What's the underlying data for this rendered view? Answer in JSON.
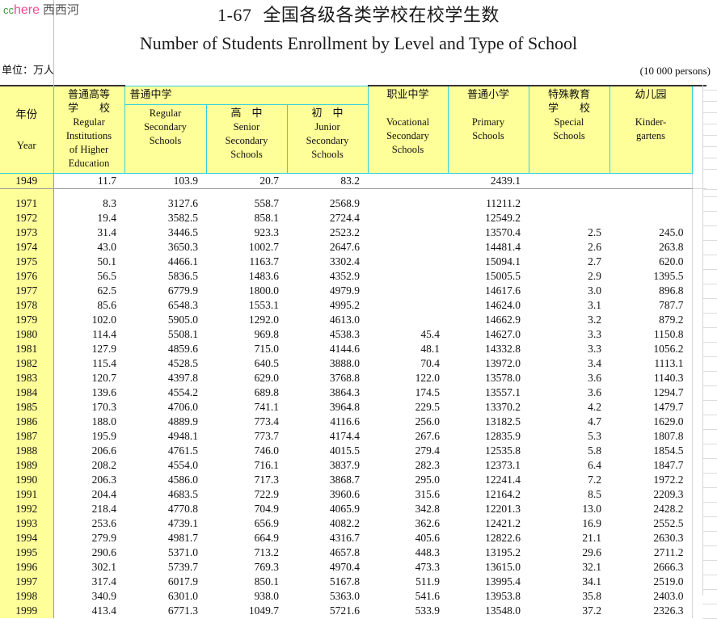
{
  "watermark": {
    "cc": "cc",
    "here": "here",
    "site_cn": "西西河"
  },
  "title": {
    "number": "1-67",
    "cn": "全国各级各类学校在校学生数",
    "en": "Number of Students Enrollment by Level and Type of School"
  },
  "unit": {
    "cn": "单位：万人",
    "en": "(10 000 persons)"
  },
  "header": {
    "year": {
      "cn": "年份",
      "en": "Year"
    },
    "higher": {
      "cn1": "普通高等",
      "cn2": "学　　校",
      "en": [
        "Regular",
        "Institutions",
        "of Higher",
        "Education"
      ]
    },
    "secondary_group": {
      "cn": "普通中学"
    },
    "regular_secondary": {
      "en": [
        "Regular",
        "Secondary",
        "Schools"
      ]
    },
    "senior": {
      "cn": "高　中",
      "en": [
        "Senior",
        "Secondary",
        "Schools"
      ]
    },
    "junior": {
      "cn": "初　中",
      "en": [
        "Junior",
        "Secondary",
        "Schools"
      ]
    },
    "vocational": {
      "cn": "职业中学",
      "en": [
        "Vocational",
        "Secondary",
        "Schools"
      ]
    },
    "primary": {
      "cn": "普通小学",
      "en": [
        "Primary",
        "Schools"
      ]
    },
    "special": {
      "cn1": "特殊教育",
      "cn2": "学　　校",
      "en": [
        "Special",
        "Schools"
      ]
    },
    "kindergarten": {
      "cn": "幼儿园",
      "en": [
        "Kinder-",
        "gartens"
      ]
    }
  },
  "chart_data": {
    "type": "table",
    "title": "1-67  全国各级各类学校在校学生数 / Number of Students Enrollment by Level and Type of School",
    "unit": "10 000 persons",
    "columns": [
      "Year",
      "Regular Institutions of Higher Education",
      "Regular Secondary Schools",
      "Senior Secondary Schools",
      "Junior Secondary Schools",
      "Vocational Secondary Schools",
      "Primary Schools",
      "Special Schools",
      "Kindergartens"
    ],
    "rows": [
      [
        "1949",
        "11.7",
        "103.9",
        "20.7",
        "83.2",
        "",
        "2439.1",
        "",
        ""
      ],
      [
        "1971",
        "8.3",
        "3127.6",
        "558.7",
        "2568.9",
        "",
        "11211.2",
        "",
        ""
      ],
      [
        "1972",
        "19.4",
        "3582.5",
        "858.1",
        "2724.4",
        "",
        "12549.2",
        "",
        ""
      ],
      [
        "1973",
        "31.4",
        "3446.5",
        "923.3",
        "2523.2",
        "",
        "13570.4",
        "2.5",
        "245.0"
      ],
      [
        "1974",
        "43.0",
        "3650.3",
        "1002.7",
        "2647.6",
        "",
        "14481.4",
        "2.6",
        "263.8"
      ],
      [
        "1975",
        "50.1",
        "4466.1",
        "1163.7",
        "3302.4",
        "",
        "15094.1",
        "2.7",
        "620.0"
      ],
      [
        "1976",
        "56.5",
        "5836.5",
        "1483.6",
        "4352.9",
        "",
        "15005.5",
        "2.9",
        "1395.5"
      ],
      [
        "1977",
        "62.5",
        "6779.9",
        "1800.0",
        "4979.9",
        "",
        "14617.6",
        "3.0",
        "896.8"
      ],
      [
        "1978",
        "85.6",
        "6548.3",
        "1553.1",
        "4995.2",
        "",
        "14624.0",
        "3.1",
        "787.7"
      ],
      [
        "1979",
        "102.0",
        "5905.0",
        "1292.0",
        "4613.0",
        "",
        "14662.9",
        "3.2",
        "879.2"
      ],
      [
        "1980",
        "114.4",
        "5508.1",
        "969.8",
        "4538.3",
        "45.4",
        "14627.0",
        "3.3",
        "1150.8"
      ],
      [
        "1981",
        "127.9",
        "4859.6",
        "715.0",
        "4144.6",
        "48.1",
        "14332.8",
        "3.3",
        "1056.2"
      ],
      [
        "1982",
        "115.4",
        "4528.5",
        "640.5",
        "3888.0",
        "70.4",
        "13972.0",
        "3.4",
        "1113.1"
      ],
      [
        "1983",
        "120.7",
        "4397.8",
        "629.0",
        "3768.8",
        "122.0",
        "13578.0",
        "3.6",
        "1140.3"
      ],
      [
        "1984",
        "139.6",
        "4554.2",
        "689.8",
        "3864.3",
        "174.5",
        "13557.1",
        "3.6",
        "1294.7"
      ],
      [
        "1985",
        "170.3",
        "4706.0",
        "741.1",
        "3964.8",
        "229.5",
        "13370.2",
        "4.2",
        "1479.7"
      ],
      [
        "1986",
        "188.0",
        "4889.9",
        "773.4",
        "4116.6",
        "256.0",
        "13182.5",
        "4.7",
        "1629.0"
      ],
      [
        "1987",
        "195.9",
        "4948.1",
        "773.7",
        "4174.4",
        "267.6",
        "12835.9",
        "5.3",
        "1807.8"
      ],
      [
        "1988",
        "206.6",
        "4761.5",
        "746.0",
        "4015.5",
        "279.4",
        "12535.8",
        "5.8",
        "1854.5"
      ],
      [
        "1989",
        "208.2",
        "4554.0",
        "716.1",
        "3837.9",
        "282.3",
        "12373.1",
        "6.4",
        "1847.7"
      ],
      [
        "1990",
        "206.3",
        "4586.0",
        "717.3",
        "3868.7",
        "295.0",
        "12241.4",
        "7.2",
        "1972.2"
      ],
      [
        "1991",
        "204.4",
        "4683.5",
        "722.9",
        "3960.6",
        "315.6",
        "12164.2",
        "8.5",
        "2209.3"
      ],
      [
        "1992",
        "218.4",
        "4770.8",
        "704.9",
        "4065.9",
        "342.8",
        "12201.3",
        "13.0",
        "2428.2"
      ],
      [
        "1993",
        "253.6",
        "4739.1",
        "656.9",
        "4082.2",
        "362.6",
        "12421.2",
        "16.9",
        "2552.5"
      ],
      [
        "1994",
        "279.9",
        "4981.7",
        "664.9",
        "4316.7",
        "405.6",
        "12822.6",
        "21.1",
        "2630.3"
      ],
      [
        "1995",
        "290.6",
        "5371.0",
        "713.2",
        "4657.8",
        "448.3",
        "13195.2",
        "29.6",
        "2711.2"
      ],
      [
        "1996",
        "302.1",
        "5739.7",
        "769.3",
        "4970.4",
        "473.3",
        "13615.0",
        "32.1",
        "2666.3"
      ],
      [
        "1997",
        "317.4",
        "6017.9",
        "850.1",
        "5167.8",
        "511.9",
        "13995.4",
        "34.1",
        "2519.0"
      ],
      [
        "1998",
        "340.9",
        "6301.0",
        "938.0",
        "5363.0",
        "541.6",
        "13953.8",
        "35.8",
        "2403.0"
      ],
      [
        "1999",
        "413.4",
        "6771.3",
        "1049.7",
        "5721.6",
        "533.9",
        "13548.0",
        "37.2",
        "2326.3"
      ]
    ]
  },
  "colors": {
    "header_fill": "#ffff99",
    "header_border": "#2fd0e0",
    "watermark_cc": "#3c9a3c",
    "watermark_here": "#ef4a94"
  }
}
